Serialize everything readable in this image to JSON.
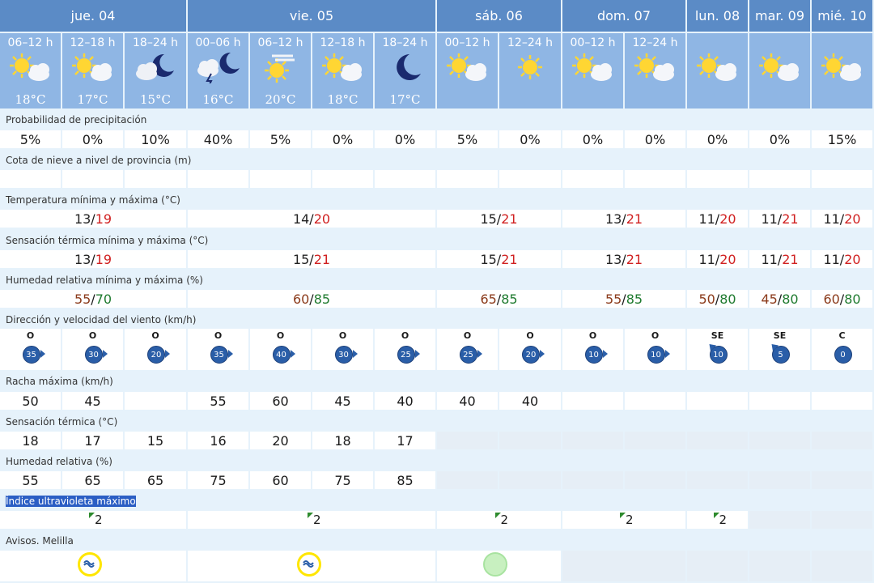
{
  "days": [
    "jue. 04",
    "vie. 05",
    "sáb. 06",
    "dom. 07",
    "lun. 08",
    "mar. 09",
    "mié. 10"
  ],
  "periods": [
    {
      "label": "06–12 h",
      "temp": "18°C",
      "icon": "sun-cloud-icon"
    },
    {
      "label": "12–18 h",
      "temp": "17°C",
      "icon": "sun-cloud-icon"
    },
    {
      "label": "18–24 h",
      "temp": "15°C",
      "icon": "moon-cloud-icon"
    },
    {
      "label": "00–06 h",
      "temp": "16°C",
      "icon": "storm-cloud-icon"
    },
    {
      "label": "06–12 h",
      "temp": "20°C",
      "icon": "haze-sun-icon"
    },
    {
      "label": "12–18 h",
      "temp": "18°C",
      "icon": "sun-cloud-icon"
    },
    {
      "label": "18–24 h",
      "temp": "17°C",
      "icon": "moon-icon"
    },
    {
      "label": "00–12 h",
      "temp": "",
      "icon": "sun-cloud-icon"
    },
    {
      "label": "12–24 h",
      "temp": "",
      "icon": "sun-icon"
    },
    {
      "label": "00–12 h",
      "temp": "",
      "icon": "sun-cloud-icon"
    },
    {
      "label": "12–24 h",
      "temp": "",
      "icon": "sun-cloud-icon"
    },
    {
      "label": "",
      "temp": "",
      "icon": "sun-cloud-icon"
    },
    {
      "label": "",
      "temp": "",
      "icon": "sun-cloud-icon"
    },
    {
      "label": "",
      "temp": "",
      "icon": "sun-cloud-icon"
    }
  ],
  "labels": {
    "precip": "Probabilidad de precipitación",
    "snow": "Cota de nieve a nivel de provincia (m)",
    "temp": "Temperatura mínima y máxima (°C)",
    "feels": "Sensación térmica mínima y máxima (°C)",
    "humidity": "Humedad relativa mínima y máxima (%)",
    "wind": "Dirección y velocidad del viento (km/h)",
    "gust": "Racha máxima (km/h)",
    "feels_period": "Sensación térmica (°C)",
    "humidity_period": "Humedad relativa (%)",
    "uv": "Índice ultravioleta máximo",
    "warnings": "Avisos. Melilla"
  },
  "precip": [
    "5%",
    "0%",
    "10%",
    "40%",
    "5%",
    "0%",
    "0%",
    "5%",
    "0%",
    "0%",
    "0%",
    "0%",
    "0%",
    "15%"
  ],
  "temp_minmax": [
    {
      "min": "13",
      "max": "19"
    },
    {
      "min": "14",
      "max": "20"
    },
    {
      "min": "15",
      "max": "21"
    },
    {
      "min": "13",
      "max": "21"
    },
    {
      "min": "11",
      "max": "20"
    },
    {
      "min": "11",
      "max": "21"
    },
    {
      "min": "11",
      "max": "20"
    }
  ],
  "feels_minmax": [
    {
      "min": "13",
      "max": "19"
    },
    {
      "min": "15",
      "max": "21"
    },
    {
      "min": "15",
      "max": "21"
    },
    {
      "min": "13",
      "max": "21"
    },
    {
      "min": "11",
      "max": "20"
    },
    {
      "min": "11",
      "max": "21"
    },
    {
      "min": "11",
      "max": "20"
    }
  ],
  "humidity_minmax": [
    {
      "min": "55",
      "max": "70"
    },
    {
      "min": "60",
      "max": "85"
    },
    {
      "min": "65",
      "max": "85"
    },
    {
      "min": "55",
      "max": "85"
    },
    {
      "min": "50",
      "max": "80"
    },
    {
      "min": "45",
      "max": "80"
    },
    {
      "min": "60",
      "max": "80"
    }
  ],
  "wind": [
    {
      "dir": "O",
      "speed": "35"
    },
    {
      "dir": "O",
      "speed": "30"
    },
    {
      "dir": "O",
      "speed": "20"
    },
    {
      "dir": "O",
      "speed": "35"
    },
    {
      "dir": "O",
      "speed": "40"
    },
    {
      "dir": "O",
      "speed": "30"
    },
    {
      "dir": "O",
      "speed": "25"
    },
    {
      "dir": "O",
      "speed": "25"
    },
    {
      "dir": "O",
      "speed": "20"
    },
    {
      "dir": "O",
      "speed": "10"
    },
    {
      "dir": "O",
      "speed": "10"
    },
    {
      "dir": "SE",
      "speed": "10"
    },
    {
      "dir": "SE",
      "speed": "5"
    },
    {
      "dir": "C",
      "speed": "0"
    }
  ],
  "gust": [
    "50",
    "45",
    "",
    "55",
    "60",
    "45",
    "40",
    "40",
    "40",
    "",
    "",
    "",
    "",
    ""
  ],
  "feels_period": [
    "18",
    "17",
    "15",
    "16",
    "20",
    "18",
    "17"
  ],
  "humidity_period": [
    "55",
    "65",
    "65",
    "75",
    "60",
    "75",
    "85"
  ],
  "uv": [
    "2",
    "2",
    "2",
    "2",
    "2"
  ],
  "warnings": [
    {
      "color": "yellow",
      "icon": "wave-warning-icon"
    },
    {
      "color": "yellow",
      "icon": "wave-warning-icon"
    },
    {
      "color": "green",
      "icon": ""
    }
  ],
  "colors": {
    "day_header": "#5b8bc6",
    "period_header": "#8fb6e4",
    "background": "#e6f2fb",
    "max_temp": "#d02020",
    "min_humidity": "#8b3a1a",
    "max_humidity": "#1e7a2e",
    "wind_badge": "#2a5ea8",
    "uv_flag": "#2e8b2e",
    "warning_yellow": "#ffe600",
    "warning_green": "#a8e3a0"
  }
}
